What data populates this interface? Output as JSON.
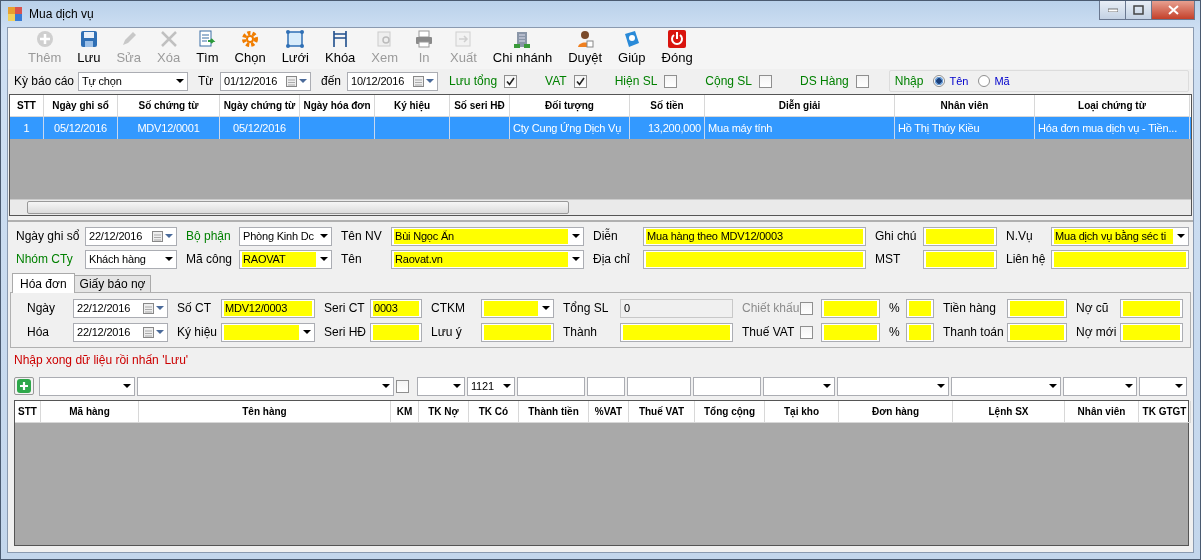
{
  "window": {
    "title": "Mua dịch vụ"
  },
  "toolbar": [
    {
      "label": "Thêm",
      "disabled": true
    },
    {
      "label": "Lưu",
      "disabled": false
    },
    {
      "label": "Sửa",
      "disabled": true
    },
    {
      "label": "Xóa",
      "disabled": true
    },
    {
      "label": "Tìm",
      "disabled": false
    },
    {
      "label": "Chọn",
      "disabled": false
    },
    {
      "label": "Lưới",
      "disabled": false
    },
    {
      "label": "Khóa",
      "disabled": false
    },
    {
      "label": "Xem",
      "disabled": true
    },
    {
      "label": "In",
      "disabled": true
    },
    {
      "label": "Xuất",
      "disabled": true
    },
    {
      "label": "Chi nhánh",
      "disabled": false
    },
    {
      "label": "Duyệt",
      "disabled": false
    },
    {
      "label": "Giúp",
      "disabled": false
    },
    {
      "label": "Đóng",
      "disabled": false
    }
  ],
  "filter": {
    "period_label": "Kỳ báo cáo",
    "period": "Tự chọn",
    "from_label": "Từ",
    "from": "01/12/2016",
    "to_label": "đến",
    "to": "10/12/2016",
    "options": [
      {
        "label": "Lưu tổng",
        "checked": true
      },
      {
        "label": "VAT",
        "checked": true
      },
      {
        "label": "Hiện SL",
        "checked": false
      },
      {
        "label": "Cộng SL",
        "checked": false
      },
      {
        "label": "DS Hàng",
        "checked": false
      }
    ],
    "input_mode": {
      "label": "Nhập",
      "choices": [
        {
          "label": "Tên",
          "selected": true
        },
        {
          "label": "Mã",
          "selected": false
        }
      ]
    }
  },
  "table": {
    "columns": [
      "STT",
      "Ngày ghi sổ",
      "Số chứng từ",
      "Ngày chứng từ",
      "Ngày hóa đơn",
      "Ký hiệu",
      "Số seri HĐ",
      "Đối tượng",
      "Số tiền",
      "Diễn giải",
      "Nhân viên",
      "Loại chứng từ"
    ],
    "rows": [
      {
        "selected": true,
        "cells": [
          "1",
          "05/12/2016",
          "MDV12/0001",
          "05/12/2016",
          null,
          null,
          null,
          "Cty Cung Ứng Dịch Vụ",
          "13,200,000",
          "Mua máy tính",
          "Hồ Thị Thúy Kiều",
          "Hóa đơn mua dịch vụ - Tiền..."
        ]
      }
    ]
  },
  "form": [
    [
      {
        "kind": "label",
        "text": "Ngày ghi sổ",
        "color": "#000000"
      },
      {
        "kind": "date",
        "value": "22/12/2016",
        "highlighted": false
      },
      {
        "kind": "label",
        "text": "Bộ phận",
        "color": "#008000"
      },
      {
        "kind": "combo",
        "value": "Phòng Kinh Dc",
        "highlighted": false
      },
      {
        "kind": "label",
        "text": "Tên NV",
        "color": "#000000"
      },
      {
        "kind": "combo",
        "value": "Bùi Ngọc Ẩn",
        "highlighted": true
      },
      {
        "kind": "label",
        "text": "Diễn",
        "color": "#000000"
      },
      {
        "kind": "input",
        "value": "Mua hàng theo MDV12/0003",
        "highlighted": true
      },
      {
        "kind": "label",
        "text": "Ghi chú",
        "color": "#000000"
      },
      {
        "kind": "input",
        "highlighted": true
      },
      {
        "kind": "label",
        "text": "N.Vụ",
        "color": "#000000"
      },
      {
        "kind": "combo",
        "value": "Mua dịch vụ bằng séc ti",
        "highlighted": true
      }
    ],
    [
      {
        "kind": "label",
        "text": "Nhóm CTy",
        "color": "#008000"
      },
      {
        "kind": "combo",
        "value": "Khách hàng",
        "highlighted": false
      },
      {
        "kind": "label",
        "text": "Mã công",
        "color": "#000000"
      },
      {
        "kind": "combo",
        "value": "RAOVAT",
        "highlighted": true
      },
      {
        "kind": "label",
        "text": "Tên",
        "color": "#000000"
      },
      {
        "kind": "combo",
        "value": "Raovat.vn",
        "highlighted": true
      },
      {
        "kind": "label",
        "text": "Địa chỉ",
        "color": "#000000"
      },
      {
        "kind": "input",
        "highlighted": true
      },
      {
        "kind": "label",
        "text": "MST",
        "color": "#000000"
      },
      {
        "kind": "input",
        "highlighted": true
      },
      {
        "kind": "label",
        "text": "Liên hệ",
        "color": "#000000"
      },
      {
        "kind": "input",
        "highlighted": true
      }
    ]
  ],
  "tabs": [
    {
      "label": "Hóa đơn",
      "selected": true
    },
    {
      "label": "Giấy báo nợ",
      "selected": false
    }
  ],
  "invoice": [
    [
      {
        "kind": "label",
        "text": "Ngày",
        "color": "#000000"
      },
      {
        "kind": "date",
        "value": "22/12/2016",
        "highlighted": false
      },
      {
        "kind": "label",
        "text": "Số CT",
        "color": "#000000"
      },
      {
        "kind": "input",
        "value": "MDV12/0003",
        "highlighted": true
      },
      {
        "kind": "label",
        "text": "Seri CT",
        "color": "#000000"
      },
      {
        "kind": "input",
        "value": "0003",
        "highlighted": true
      },
      {
        "kind": "label",
        "text": "CTKM",
        "color": "#000000"
      },
      {
        "kind": "combo",
        "highlighted": true
      },
      {
        "kind": "label",
        "text": "Tổng SL",
        "color": "#000000"
      },
      {
        "kind": "display",
        "value": "0"
      },
      {
        "kind": "label",
        "text": "Chiết khấu",
        "color": "#8c8c8c"
      },
      {
        "kind": "check",
        "checked": false
      },
      {
        "kind": "input",
        "highlighted": true
      },
      {
        "kind": "label",
        "text": "%"
      },
      {
        "kind": "input",
        "highlighted": true
      },
      {
        "kind": "label",
        "text": "Tiền hàng",
        "color": "#000000"
      },
      {
        "kind": "input",
        "highlighted": true
      },
      {
        "kind": "label",
        "text": "Nợ cũ",
        "color": "#000000"
      },
      {
        "kind": "input",
        "highlighted": true
      }
    ],
    [
      {
        "kind": "label",
        "text": "Hóa",
        "color": "#000000"
      },
      {
        "kind": "date",
        "value": "22/12/2016",
        "highlighted": false
      },
      {
        "kind": "label",
        "text": "Ký hiệu",
        "color": "#000000"
      },
      {
        "kind": "combo",
        "highlighted": true
      },
      {
        "kind": "label",
        "text": "Seri HĐ",
        "color": "#000000"
      },
      {
        "kind": "input",
        "highlighted": true
      },
      {
        "kind": "label",
        "text": "Lưu ý",
        "color": "#000000"
      },
      {
        "kind": "input",
        "highlighted": true
      },
      {
        "kind": "label",
        "text": "Thành",
        "color": "#000000"
      },
      {
        "kind": "input",
        "highlighted": true
      },
      {
        "kind": "label",
        "text": "Thuế VAT",
        "color": "#000000"
      },
      {
        "kind": "check",
        "checked": false
      },
      {
        "kind": "input",
        "highlighted": true
      },
      {
        "kind": "label",
        "text": "%"
      },
      {
        "kind": "input",
        "highlighted": true
      },
      {
        "kind": "label",
        "text": "Thanh toán",
        "color": "#000000"
      },
      {
        "kind": "input",
        "highlighted": true
      },
      {
        "kind": "label",
        "text": "Nợ mới",
        "color": "#000000"
      },
      {
        "kind": "input",
        "highlighted": true
      }
    ]
  ],
  "hint": "Nhập xong dữ liệu rồi nhấn 'Lưu'",
  "detail_entry": [
    {
      "kind": "combo"
    },
    {
      "kind": "combo"
    },
    {
      "kind": "check",
      "checked": false
    },
    {
      "kind": "combo"
    },
    {
      "kind": "combo",
      "value": "1121"
    },
    {
      "kind": "input"
    },
    {
      "kind": "input"
    },
    {
      "kind": "input"
    },
    {
      "kind": "input"
    },
    {
      "kind": "combo"
    },
    {
      "kind": "combo"
    },
    {
      "kind": "combo"
    },
    {
      "kind": "combo"
    },
    {
      "kind": "combo"
    }
  ],
  "detail_table": {
    "columns": [
      "STT",
      "Mã hàng",
      "Tên hàng",
      "KM",
      "TK Nợ",
      "TK Có",
      "Thành tiền",
      "%VAT",
      "Thuế VAT",
      "Tổng cộng",
      "Tại kho",
      "Đơn hàng",
      "Lệnh SX",
      "Nhân viên",
      "TK GTGT"
    ]
  }
}
